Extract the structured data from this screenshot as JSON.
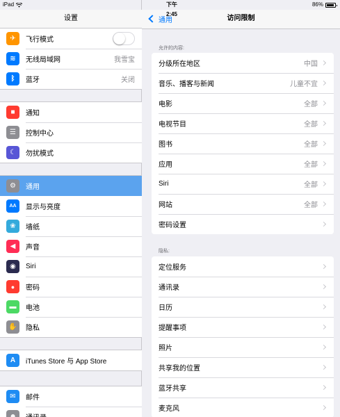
{
  "statusbar": {
    "device": "iPad",
    "wifi_icon": "wifi-icon",
    "time": "下午2:45",
    "battery": "86%"
  },
  "left": {
    "title": "设置",
    "groups": [
      [
        {
          "label": "飞行模式",
          "icon": "airplane-icon",
          "color": "#ff9500",
          "toggle": false
        },
        {
          "label": "无线局域网",
          "value": "我雪宝",
          "icon": "wifi-icon",
          "color": "#007aff"
        },
        {
          "label": "蓝牙",
          "value": "关闭",
          "icon": "bluetooth-icon",
          "color": "#007aff"
        }
      ],
      [
        {
          "label": "通知",
          "icon": "notifications-icon",
          "color": "#ff3b30"
        },
        {
          "label": "控制中心",
          "icon": "control-center-icon",
          "color": "#8e8e93"
        },
        {
          "label": "勿扰模式",
          "icon": "moon-icon",
          "color": "#5856d6"
        }
      ],
      [
        {
          "label": "通用",
          "icon": "gear-icon",
          "color": "#8e8e93",
          "selected": true
        },
        {
          "label": "显示与亮度",
          "icon": "display-icon",
          "color": "#007aff"
        },
        {
          "label": "墙纸",
          "icon": "wallpaper-icon",
          "color": "#34aadc"
        },
        {
          "label": "声音",
          "icon": "sound-icon",
          "color": "#ff2d55"
        },
        {
          "label": "Siri",
          "icon": "siri-icon",
          "color": "#2b2b4f"
        },
        {
          "label": "密码",
          "icon": "lock-icon",
          "color": "#ff3b30"
        },
        {
          "label": "电池",
          "icon": "battery-icon",
          "color": "#4cd964"
        },
        {
          "label": "隐私",
          "icon": "hand-icon",
          "color": "#8e8e93"
        }
      ],
      [
        {
          "label": "iTunes Store 与 App Store",
          "icon": "app-store-icon",
          "color": "#1e8cf3"
        }
      ],
      [
        {
          "label": "邮件",
          "icon": "mail-icon",
          "color": "#1e8cf3"
        },
        {
          "label": "通讯录",
          "icon": "contacts-icon",
          "color": "#8e8e93"
        }
      ]
    ]
  },
  "right": {
    "back_label": "通用",
    "title": "访问限制",
    "allowed_section": {
      "header": "允许的内容:",
      "items": [
        {
          "label": "分级所在地区",
          "value": "中国"
        },
        {
          "label": "音乐、播客与新闻",
          "value": "儿童不宜"
        },
        {
          "label": "电影",
          "value": "全部"
        },
        {
          "label": "电视节目",
          "value": "全部"
        },
        {
          "label": "图书",
          "value": "全部"
        },
        {
          "label": "应用",
          "value": "全部"
        },
        {
          "label": "Siri",
          "value": "全部"
        },
        {
          "label": "网站",
          "value": "全部"
        },
        {
          "label": "密码设置",
          "value": ""
        }
      ]
    },
    "privacy_section": {
      "header": "隐私:",
      "items": [
        {
          "label": "定位服务"
        },
        {
          "label": "通讯录"
        },
        {
          "label": "日历"
        },
        {
          "label": "提醒事项"
        },
        {
          "label": "照片"
        },
        {
          "label": "共享我的位置"
        },
        {
          "label": "蓝牙共享"
        },
        {
          "label": "麦克风"
        }
      ]
    }
  }
}
